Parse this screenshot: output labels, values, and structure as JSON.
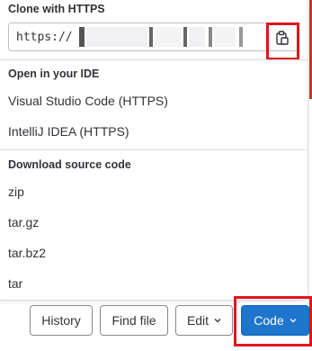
{
  "clone_https": {
    "heading": "Clone with HTTPS",
    "url_value": "https://",
    "copy_icon": "clipboard-copy-icon"
  },
  "open_in_ide": {
    "heading": "Open in your IDE",
    "items": [
      {
        "label": "Visual Studio Code (HTTPS)"
      },
      {
        "label": "IntelliJ IDEA (HTTPS)"
      }
    ]
  },
  "download_source": {
    "heading": "Download source code",
    "items": [
      {
        "label": "zip"
      },
      {
        "label": "tar.gz"
      },
      {
        "label": "tar.bz2"
      },
      {
        "label": "tar"
      }
    ]
  },
  "toolbar": {
    "history_label": "History",
    "find_file_label": "Find file",
    "edit_label": "Edit",
    "code_label": "Code"
  },
  "colors": {
    "primary": "#1f75cb",
    "highlight": "#e0151c",
    "text": "#333238"
  }
}
